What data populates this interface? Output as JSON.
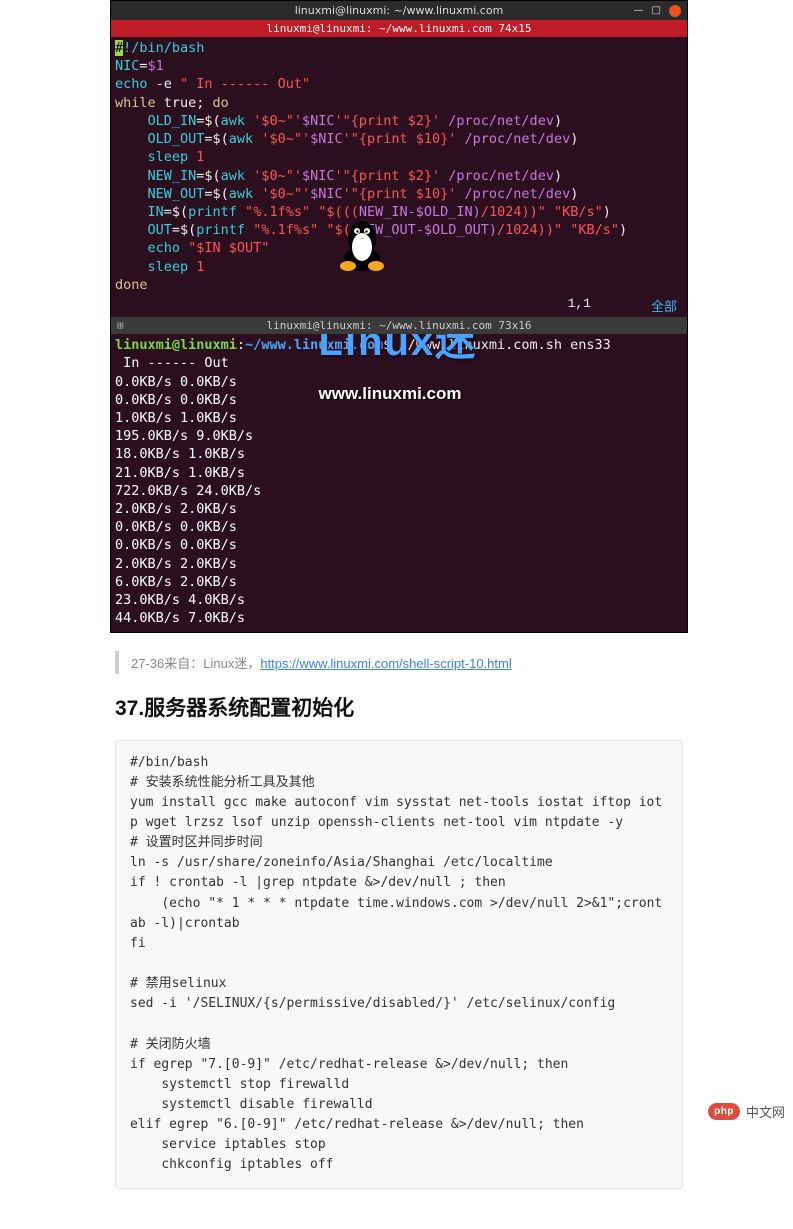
{
  "terminal": {
    "window_title": "linuxmi@linuxmi: ~/www.linuxmi.com",
    "tab1_title": "linuxmi@linuxmi: ~/www.linuxmi.com 74x15",
    "tab2_title": "linuxmi@linuxmi: ~/www.linuxmi.com 73x16",
    "status_pos": "1,1",
    "status_all": "全部",
    "script": {
      "l1a": "#",
      "l1b": "!/bin/bash",
      "l2a": "NIC",
      "l2b": "=",
      "l2c": "$1",
      "l3a": "echo",
      "l3b": " -e ",
      "l3c": "\" In ------ Out\"",
      "l4a": "while",
      "l4b": " true; ",
      "l4c": "do",
      "l5a": "    OLD_IN",
      "l5b": "=$(",
      "l5c": "awk ",
      "l5d": "'$0~\"'",
      "l5e": "$NIC",
      "l5f": "'\"{print $2}'",
      "l5g": " /proc/net/dev",
      "l5h": ")",
      "l6a": "    OLD_OUT",
      "l6b": "=$(",
      "l6c": "awk ",
      "l6d": "'$0~\"'",
      "l6e": "$NIC",
      "l6f": "'\"{print $10}'",
      "l6g": " /proc/net/dev",
      "l6h": ")",
      "l7a": "    sleep ",
      "l7b": "1",
      "l8a": "    NEW_IN",
      "l8b": "=$(",
      "l8c": "awk ",
      "l8d": "'$0~\"'",
      "l8e": "$NIC",
      "l8f": "'\"{print $2}'",
      "l8g": " /proc/net/dev",
      "l8h": ")",
      "l9a": "    NEW_OUT",
      "l9b": "=$(",
      "l9c": "awk ",
      "l9d": "'$0~\"'",
      "l9e": "$NIC",
      "l9f": "'\"{print $10}'",
      "l9g": " /proc/net/dev",
      "l9h": ")",
      "l10a": "    IN",
      "l10b": "=$(",
      "l10c": "printf ",
      "l10d": "\"%.1f%s\"",
      "l10e": " \"$(((",
      "l10f": "NEW_IN-$OLD_IN)",
      "l10g": "/1024))\" ",
      "l10h": "\"KB/s\"",
      "l10i": ")",
      "l11a": "    OUT",
      "l11b": "=$(",
      "l11c": "printf ",
      "l11d": "\"%.1f%s\"",
      "l11e": " \"$((",
      "l11f": "NEW_OUT-$OLD_OUT)",
      "l11g": "/1024))\" ",
      "l11h": "\"KB/s\"",
      "l11i": ")",
      "l12a": "    echo ",
      "l12b": "\"$IN $OUT\"",
      "l13a": "    sleep ",
      "l13b": "1",
      "l14": "done"
    },
    "prompt_user": "linuxmi@linuxmi",
    "prompt_sep": ":",
    "prompt_path": "~/www.linuxmi.com",
    "prompt_cmd": "$ ./www.linuxmi.com.sh ens33",
    "output": [
      " In ------ Out",
      "0.0KB/s 0.0KB/s",
      "0.0KB/s 0.0KB/s",
      "1.0KB/s 1.0KB/s",
      "195.0KB/s 9.0KB/s",
      "18.0KB/s 1.0KB/s",
      "21.0KB/s 1.0KB/s",
      "722.0KB/s 24.0KB/s",
      "2.0KB/s 2.0KB/s",
      "0.0KB/s 0.0KB/s",
      "0.0KB/s 0.0KB/s",
      "2.0KB/s 2.0KB/s",
      "6.0KB/s 2.0KB/s",
      "23.0KB/s 4.0KB/s",
      "44.0KB/s 7.0KB/s"
    ]
  },
  "overlay": {
    "brand": "Linux迷",
    "url": "www.linuxmi.com"
  },
  "quote": {
    "prefix": "27-36来自：Linux迷，",
    "link_text": "https://www.linuxmi.com/shell-script-10.html"
  },
  "heading": "37.服务器系统配置初始化",
  "codeblock": "#/bin/bash\n# 安装系统性能分析工具及其他\nyum install gcc make autoconf vim sysstat net-tools iostat iftop iotp wget lrzsz lsof unzip openssh-clients net-tool vim ntpdate -y\n# 设置时区并同步时间\nln -s /usr/share/zoneinfo/Asia/Shanghai /etc/localtime\nif ! crontab -l |grep ntpdate &>/dev/null ; then\n    (echo \"* 1 * * * ntpdate time.windows.com >/dev/null 2>&1\";crontab -l)|crontab\nfi\n\n# 禁用selinux\nsed -i '/SELINUX/{s/permissive/disabled/}' /etc/selinux/config\n\n# 关闭防火墙\nif egrep \"7.[0-9]\" /etc/redhat-release &>/dev/null; then\n    systemctl stop firewalld\n    systemctl disable firewalld\nelif egrep \"6.[0-9]\" /etc/redhat-release &>/dev/null; then\n    service iptables stop\n    chkconfig iptables off",
  "watermark": {
    "badge": "php",
    "text": "中文网"
  }
}
